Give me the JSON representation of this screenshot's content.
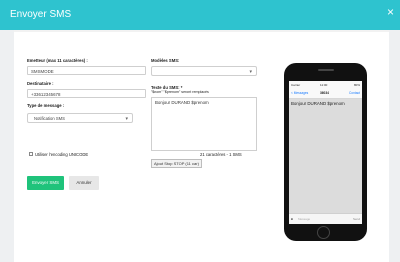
{
  "modal": {
    "title": "Envoyer SMS",
    "close_icon": "×"
  },
  "form": {
    "sender_label": "Emetteur (max 11 caractères) :",
    "sender_value": "SMSMODE",
    "recipient_label": "Destinataire :",
    "recipient_value": "+33612345678",
    "type_label": "Type de message :",
    "type_value": "Notification SMS",
    "unicode_label": "Utiliser l'encoding UNICODE",
    "submit_label": "Envoyer SMS",
    "cancel_label": "Annuler",
    "templates_label": "Modèles SMS:",
    "templates_value": "",
    "text_label": "Texte du SMS: *",
    "text_hint": "\"$nom\" \"$prenom\" seront remplacés",
    "text_value": "Bonjour DURAND $prenom",
    "counter": "21 caractères - 1 SMS",
    "stop_button": "Ajout Stop STOP (11 car)"
  },
  "phone_preview": {
    "status_carrier": "Carrier",
    "status_time": "11:00",
    "status_battery": "80%",
    "back_label": "< Messages",
    "number": "36034",
    "contact_label": "Contact",
    "message": "Bonjour DURAND $prenom",
    "input_placeholder": "Message",
    "send_label": "Send"
  },
  "colors": {
    "header": "#2ec3cf",
    "primary_button": "#1fc37b"
  }
}
